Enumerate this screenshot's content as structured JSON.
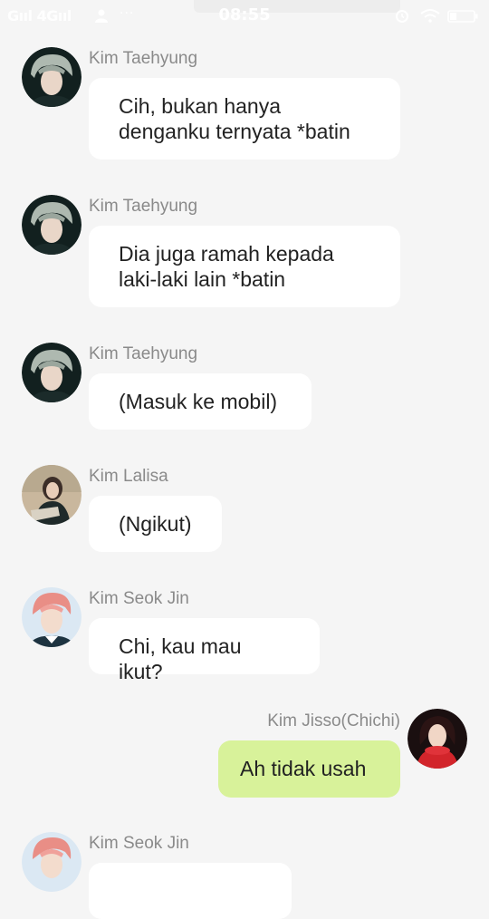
{
  "status_bar": {
    "signal": "Gııl 4Gııl",
    "dots": "···",
    "time": "08:55"
  },
  "colors": {
    "background": "#f5f5f5",
    "incoming_bubble": "#ffffff",
    "outgoing_bubble": "#d8f29a",
    "sender_name": "#8a8a8a"
  },
  "messages": [
    {
      "sender": "Kim Taehyung",
      "side": "left",
      "avatar": "taehyung-avatar",
      "text": "Cih, bukan hanya\ndenganku ternyata *batin"
    },
    {
      "sender": "Kim Taehyung",
      "side": "left",
      "avatar": "taehyung-avatar",
      "text": "Dia juga ramah kepada\nlaki-laki lain *batin"
    },
    {
      "sender": "Kim Taehyung",
      "side": "left",
      "avatar": "taehyung-avatar",
      "text": "(Masuk ke mobil)"
    },
    {
      "sender": "Kim Lalisa",
      "side": "left",
      "avatar": "lalisa-avatar",
      "text": "(Ngikut)"
    },
    {
      "sender": "Kim Seok Jin",
      "side": "left",
      "avatar": "seokjin-avatar",
      "text": "Chi, kau mau ikut?"
    },
    {
      "sender": "Kim Jisso(Chichi)",
      "side": "right",
      "avatar": "jisoo-avatar",
      "text": "Ah tidak usah"
    },
    {
      "sender": "Kim Seok Jin",
      "side": "left",
      "avatar": "seokjin-avatar",
      "text": ""
    }
  ]
}
